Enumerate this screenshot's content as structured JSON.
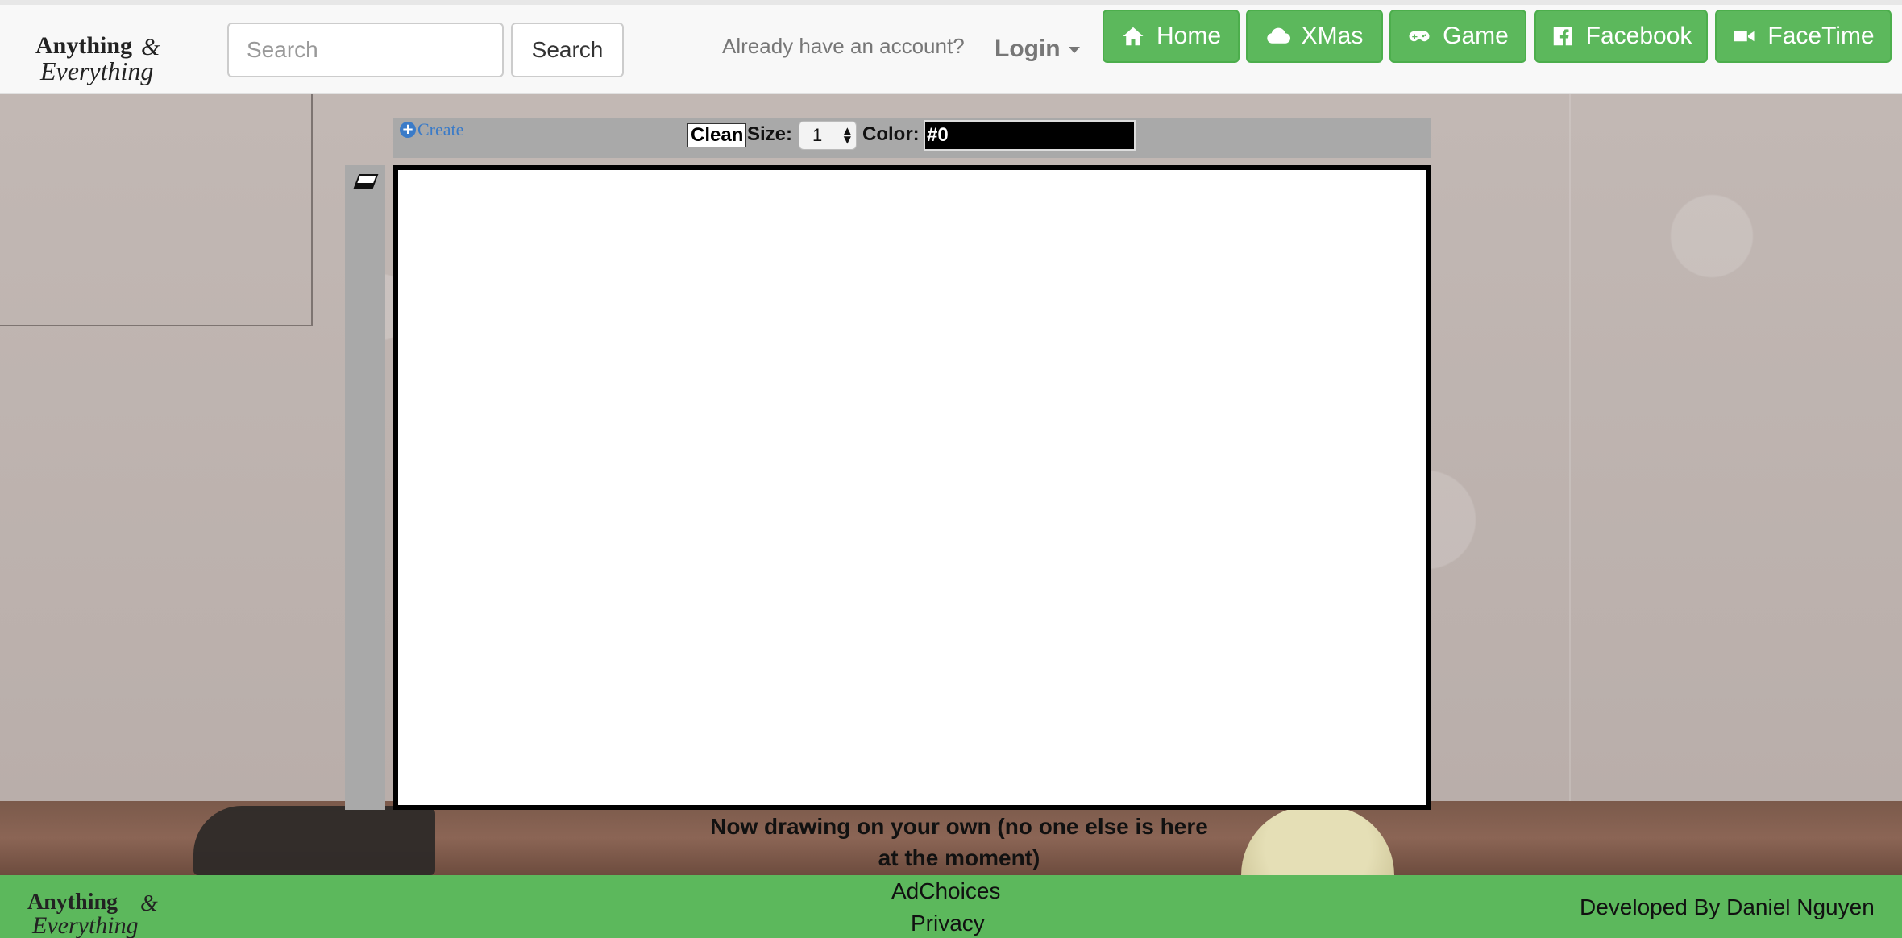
{
  "header": {
    "logo_line1": "Anything",
    "logo_amp": "&",
    "logo_line2": "Everything",
    "search_placeholder": "Search",
    "search_button": "Search",
    "account_prompt": "Already have an account?",
    "login_label": "Login"
  },
  "nav": [
    {
      "label": "Home",
      "icon": "home-icon"
    },
    {
      "label": "XMas",
      "icon": "cloud-icon"
    },
    {
      "label": "Game",
      "icon": "gamepad-icon"
    },
    {
      "label": "Facebook",
      "icon": "facebook-icon"
    },
    {
      "label": "FaceTime",
      "icon": "video-camera-icon"
    }
  ],
  "toolbar": {
    "create_label": "Create",
    "clean_label": "Clean",
    "size_label": "Size:",
    "size_value": "1",
    "color_label": "Color:",
    "color_value": "#0"
  },
  "status": "Now drawing on your own (no one else is here at the moment)",
  "footer": {
    "logo_line1": "Anything",
    "logo_amp": "&",
    "logo_line2": "Everything",
    "adchoices": "AdChoices",
    "privacy": "Privacy",
    "developer": "Developed By Daniel Nguyen"
  },
  "colors": {
    "accent_green": "#5cb85c",
    "toolbar_gray": "#a9a9a9",
    "link_blue": "#3a7bc8"
  }
}
